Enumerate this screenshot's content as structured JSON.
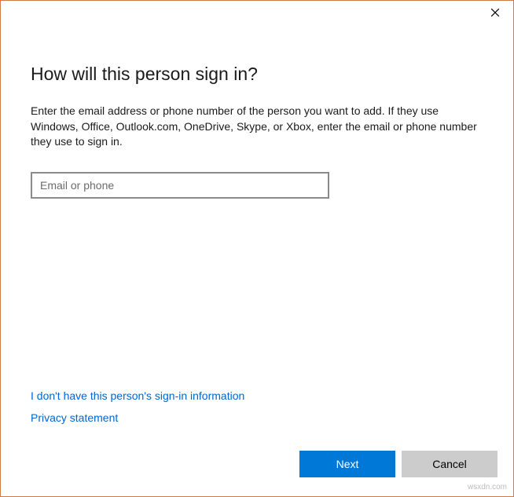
{
  "dialog": {
    "heading": "How will this person sign in?",
    "description": "Enter the email address or phone number of the person you want to add. If they use Windows, Office, Outlook.com, OneDrive, Skype, or Xbox, enter the email or phone number they use to sign in.",
    "input": {
      "placeholder": "Email or phone",
      "value": ""
    },
    "links": {
      "no_info": "I don't have this person's sign-in information",
      "privacy": "Privacy statement"
    },
    "buttons": {
      "next": "Next",
      "cancel": "Cancel"
    }
  },
  "watermark": "wsxdn.com"
}
